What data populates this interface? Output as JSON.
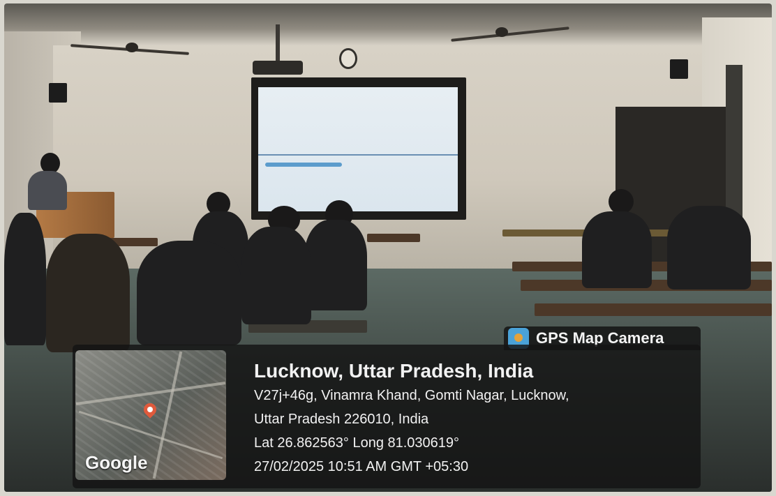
{
  "overlay": {
    "app_name": "GPS Map Camera",
    "place": "Lucknow, Uttar Pradesh, India",
    "address_line1": "V27j+46g, Vinamra Khand, Gomti Nagar, Lucknow,",
    "address_line2": "Uttar Pradesh 226010, India",
    "coordinates": "Lat 26.862563° Long 81.030619°",
    "datetime": "27/02/2025 10:51 AM GMT +05:30",
    "map_provider": "Google"
  },
  "icons": {
    "app": "location-camera-icon",
    "map_pin": "map-pin-icon"
  },
  "colors": {
    "overlay_bg": "#141414",
    "overlay_text": "#f2f2f2",
    "pin": "#e05a3c",
    "app_icon": "#4aa2d8"
  }
}
